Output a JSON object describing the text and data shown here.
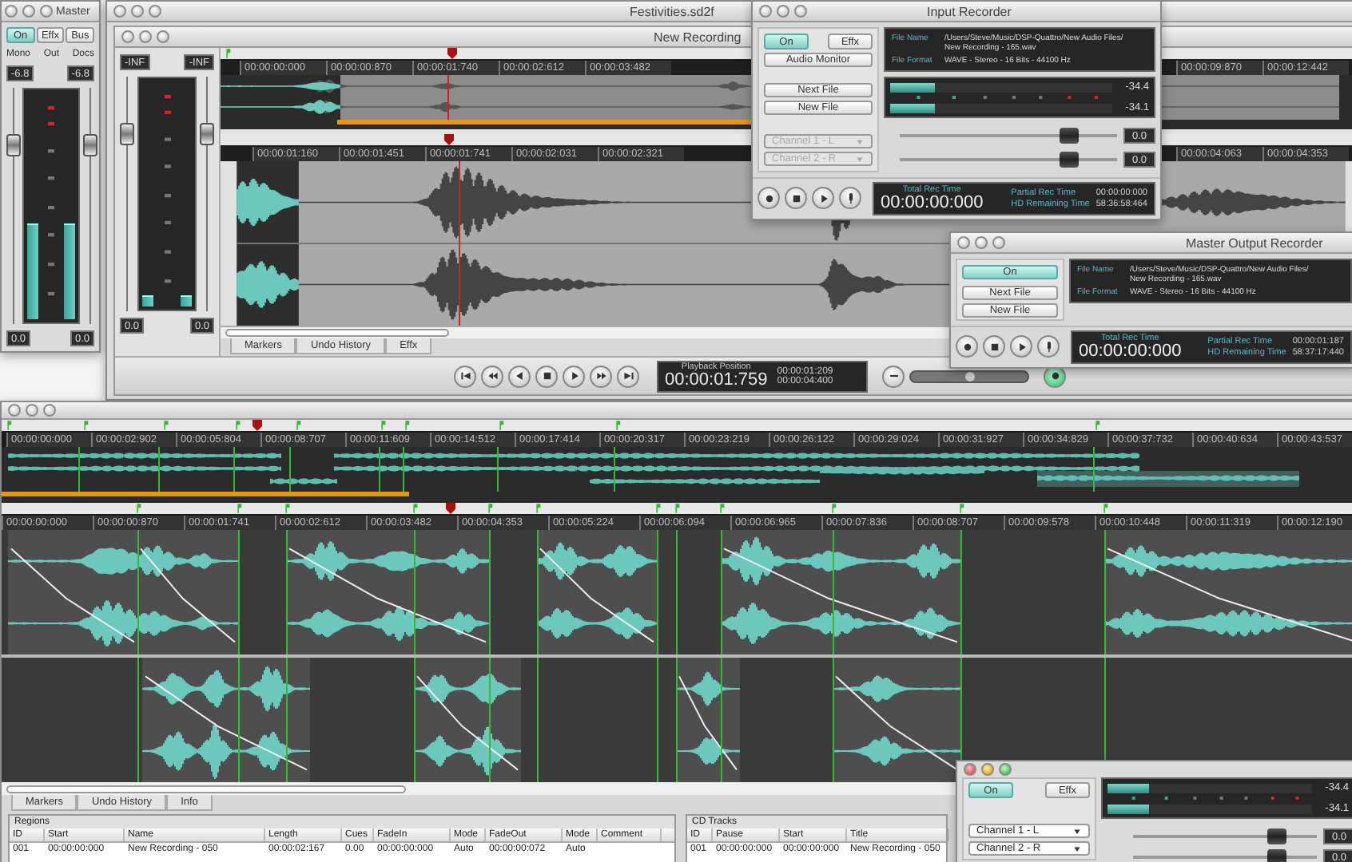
{
  "master_window": {
    "title": "Master",
    "buttons": [
      {
        "label": "On",
        "selected": true
      },
      {
        "label": "Effx",
        "selected": false
      },
      {
        "label": "Bus",
        "selected": false
      }
    ],
    "options": [
      "Mono",
      "Out",
      "Docs"
    ],
    "peak_readouts": [
      "-6.8",
      "-6.8"
    ],
    "faders": [
      {
        "level": 0.78
      },
      {
        "level": 0.78
      }
    ],
    "meters": [
      {
        "level": 0.42
      },
      {
        "level": 0.42
      }
    ],
    "gain_readouts": [
      "0.0",
      "0.0"
    ]
  },
  "document_window": {
    "title": "Festivities.sd2f",
    "document_title": "New Recording",
    "peak_readouts": [
      "-INF",
      "-INF"
    ],
    "faders": [
      {
        "level": 0.78
      },
      {
        "level": 0.78
      }
    ],
    "meters": [
      {
        "level": 0.05
      },
      {
        "level": 0.05
      }
    ],
    "gain_readouts": [
      "0.0",
      "0.0"
    ],
    "overview_ruler": [
      "00:00:00:000",
      "00:00:00:870",
      "00:00:01:740",
      "00:00:02:612",
      "00:00:03:482"
    ],
    "overview_ruler_right": [
      "00:00:09:870",
      "00:00:12:442"
    ],
    "ruler": [
      "00:00:01:160",
      "00:00:01:451",
      "00:00:01:741",
      "00:00:02:031",
      "00:00:02:321"
    ],
    "ruler_right": [
      "00:00:04:063",
      "00:00:04:353"
    ],
    "tabs": [
      {
        "label": "Markers",
        "selected": false
      },
      {
        "label": "Undo History",
        "selected": false
      },
      {
        "label": "Effx",
        "selected": false
      }
    ],
    "playback": {
      "label": "Playback Position",
      "time": "00:00:01:759",
      "start": "00:00:01:209",
      "end": "00:00:04:400"
    },
    "zoom_slider": {
      "level": 0.5
    }
  },
  "input_recorder": {
    "kind": "full",
    "title": "Input Recorder",
    "buttons": [
      {
        "label": "On",
        "selected": true
      },
      {
        "label": "Effx",
        "selected": false
      },
      {
        "label": "Audio Monitor",
        "selected": false
      }
    ],
    "file_buttons": [
      "Next File",
      "New File"
    ],
    "channels": [
      {
        "label": "Channel 1 - L",
        "disabled": true
      },
      {
        "label": "Channel 2 - R",
        "disabled": true
      }
    ],
    "file_name_label": "File Name",
    "file_name": [
      "/Users/Steve/Music/DSP-Quattro/New Audio Files/",
      "New Recording - 165.wav"
    ],
    "file_format_label": "File Format",
    "file_format": "WAVE - Stereo - 16 Bits - 44100 Hz",
    "meters": [
      {
        "level": 0.2,
        "reading": "-34.4"
      },
      {
        "level": 0.2,
        "reading": "-34.1"
      }
    ],
    "gains": [
      {
        "level": 0.78,
        "reading": "0.0"
      },
      {
        "level": 0.78,
        "reading": "0.0"
      }
    ],
    "total_label": "Total Rec Time",
    "total": "00:00:00:000",
    "partial_label": "Partial Rec Time",
    "partial": "00:00:00:000",
    "remaining_label": "HD Remaining Time",
    "remaining": "58:36:58:464"
  },
  "master_output_recorder": {
    "kind": "compact",
    "title": "Master Output Recorder",
    "buttons": [
      {
        "label": "On",
        "selected": true
      }
    ],
    "file_buttons": [
      "Next File",
      "New File"
    ],
    "file_name_label": "File Name",
    "file_name": [
      "/Users/Steve/Music/DSP-Quattro/New Audio Files/",
      "New Recording - 165.wav"
    ],
    "file_format_label": "File Format",
    "file_format": "WAVE - Stereo - 16 Bits - 44100 Hz",
    "total_label": "Total Rec Time",
    "total": "00:00:00:000",
    "partial_label": "Partial Rec Time",
    "partial": "00:00:01:187",
    "remaining_label": "HD Remaining Time",
    "remaining": "58:37:17:440"
  },
  "playlist_window": {
    "overview_ruler": [
      "00:00:00:000",
      "00:00:02:902",
      "00:00:05:804",
      "00:00:08:707",
      "00:00:11:609",
      "00:00:14:512",
      "00:00:17:414",
      "00:00:20:317",
      "00:00:23:219",
      "00:00:26:122",
      "00:00:29:024",
      "00:00:31:927",
      "00:00:34:829",
      "00:00:37:732",
      "00:00:40:634",
      "00:00:43:537"
    ],
    "ruler": [
      "00:00:00:000",
      "00:00:00:870",
      "00:00:01:741",
      "00:00:02:612",
      "00:00:03:482",
      "00:00:04:353",
      "00:00:05:224",
      "00:00:06:094",
      "00:00:06:965",
      "00:00:07:836",
      "00:00:08:707",
      "00:00:09:578",
      "00:00:10:448",
      "00:00:11:319",
      "00:00:12:190"
    ],
    "tabs": [
      {
        "label": "Markers",
        "selected": false
      },
      {
        "label": "Undo History",
        "selected": false
      },
      {
        "label": "Info",
        "selected": false
      }
    ],
    "regions": {
      "title": "Regions",
      "columns": [
        "ID",
        "Start",
        "Name",
        "Length",
        "Cues",
        "FadeIn",
        "Mode",
        "FadeOut",
        "Mode",
        "Comment"
      ],
      "rows": [
        [
          "001",
          "00:00:00:000",
          "New Recording - 050",
          "00:00:02:167",
          "0.00",
          "00:00:00:000",
          "Auto",
          "00:00:00:072",
          "Auto"
        ]
      ]
    },
    "cd_tracks": {
      "title": "CD Tracks",
      "columns": [
        "ID",
        "Pause",
        "Start",
        "Title"
      ],
      "rows": [
        [
          "001",
          "00:00:00:000",
          "00:00:00:000",
          "New Recording - 050"
        ]
      ]
    }
  },
  "mini_recorder": {
    "buttons": [
      {
        "label": "On",
        "selected": true
      },
      {
        "label": "Effx",
        "selected": false
      }
    ],
    "channels": [
      {
        "label": "Channel 1 - L",
        "disabled": false
      },
      {
        "label": "Channel 2 - R",
        "disabled": false
      }
    ],
    "meters": [
      {
        "level": 0.2,
        "reading": "-34.4"
      },
      {
        "level": 0.2,
        "reading": "-34.1"
      }
    ],
    "gains": [
      {
        "level": 0.78,
        "reading": "0.0"
      },
      {
        "level": 0.78,
        "reading": "0.0"
      }
    ]
  }
}
